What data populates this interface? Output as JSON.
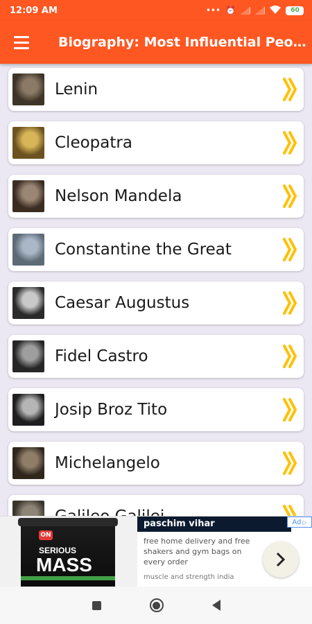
{
  "status_bar": {
    "time": "12:09 AM",
    "battery": "60"
  },
  "app_bar": {
    "title": "Biography: Most Influential People"
  },
  "items": [
    {
      "name": "Lenin",
      "thumb": "portrait-thumbnail",
      "thumb_colors": [
        "#8a7a66",
        "#3e3427"
      ]
    },
    {
      "name": "Cleopatra",
      "thumb": "portrait-thumbnail",
      "thumb_colors": [
        "#d8b658",
        "#6b5220"
      ]
    },
    {
      "name": "Nelson Mandela",
      "thumb": "portrait-thumbnail",
      "thumb_colors": [
        "#9a8674",
        "#3b2c22"
      ]
    },
    {
      "name": "Constantine the Great",
      "thumb": "statue-thumbnail",
      "thumb_colors": [
        "#a9b7c6",
        "#5d6b77"
      ]
    },
    {
      "name": "Caesar Augustus",
      "thumb": "portrait-thumbnail",
      "thumb_colors": [
        "#c9c9c9",
        "#2a2a2a"
      ]
    },
    {
      "name": "Fidel Castro",
      "thumb": "portrait-thumbnail",
      "thumb_colors": [
        "#9e9e9e",
        "#262626"
      ]
    },
    {
      "name": "Josip Broz Tito",
      "thumb": "portrait-thumbnail",
      "thumb_colors": [
        "#b5b5b5",
        "#1f1f1f"
      ]
    },
    {
      "name": "Michelangelo",
      "thumb": "portrait-thumbnail",
      "thumb_colors": [
        "#8f7d68",
        "#2f261c"
      ]
    },
    {
      "name": "Galileo Galilei",
      "thumb": "portrait-thumbnail",
      "thumb_colors": [
        "#8d8576",
        "#3a342b"
      ]
    }
  ],
  "ad": {
    "title": "paschim vihar",
    "badge": "Ad",
    "description": "free home delivery and free shakers and gym bags on every order",
    "subtitle": "muscle and strength india",
    "product": {
      "brand": "ON",
      "line1": "SERIOUS",
      "line2": "MASS"
    }
  },
  "colors": {
    "primary": "#ff5722",
    "chevron": "#ffc107",
    "list_bg": "#ebe7f3"
  }
}
